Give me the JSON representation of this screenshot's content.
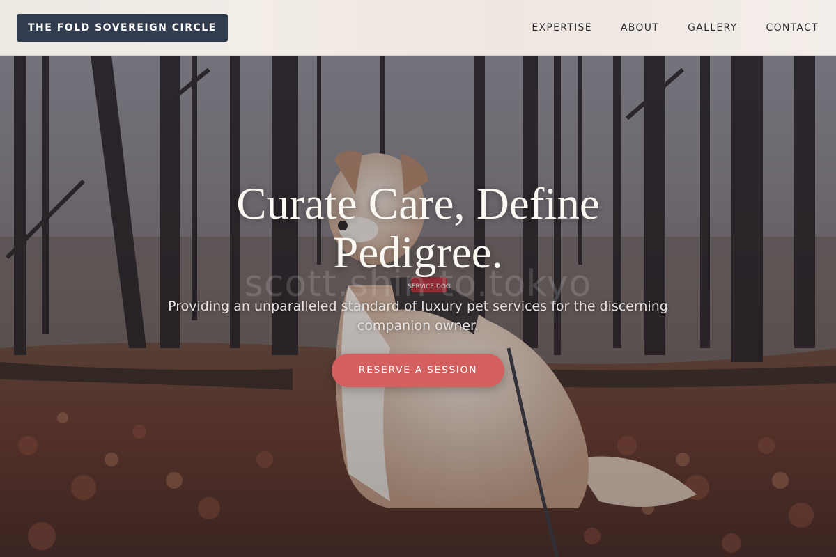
{
  "brand": {
    "name": "THE FOLD SOVEREIGN CIRCLE"
  },
  "nav": {
    "items": [
      "EXPERTISE",
      "ABOUT",
      "GALLERY",
      "CONTACT"
    ]
  },
  "hero": {
    "headline": "Curate Care, Define Pedigree.",
    "watermark": "scott.shin to.tokyo",
    "subtitle": "Providing an unparalleled standard of luxury pet services for the discerning companion owner.",
    "cta_label": "RESERVE A SESSION",
    "harness_text": "SERVICE DOG"
  },
  "colors": {
    "brand_bg": "#323c4f",
    "cta_bg": "#d3605e",
    "header_bg": "#efe9e4"
  }
}
